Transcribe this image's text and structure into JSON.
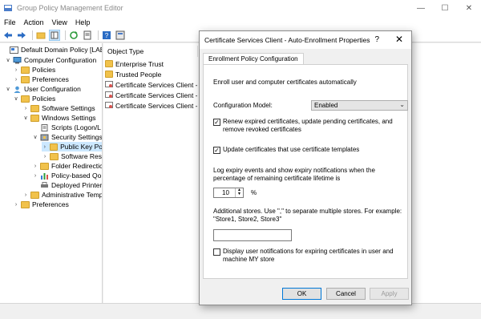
{
  "window": {
    "title": "Group Policy Management Editor"
  },
  "menu": {
    "file": "File",
    "action": "Action",
    "view": "View",
    "help": "Help"
  },
  "tree": [
    {
      "label": "Default Domain Policy [LABDC",
      "indent": 0
    },
    {
      "label": "Computer Configuration",
      "indent": 1
    },
    {
      "label": "Policies",
      "indent": 2
    },
    {
      "label": "Preferences",
      "indent": 2
    },
    {
      "label": "User Configuration",
      "indent": 1
    },
    {
      "label": "Policies",
      "indent": 2
    },
    {
      "label": "Software Settings",
      "indent": 3
    },
    {
      "label": "Windows Settings",
      "indent": 3
    },
    {
      "label": "Scripts (Logon/L",
      "indent": 4
    },
    {
      "label": "Security Settings",
      "indent": 4
    },
    {
      "label": "Public Key Po",
      "indent": 5
    },
    {
      "label": "Software Res",
      "indent": 5
    },
    {
      "label": "Folder Redirectic",
      "indent": 4
    },
    {
      "label": "Policy-based Qo",
      "indent": 4
    },
    {
      "label": "Deployed Printer",
      "indent": 4
    },
    {
      "label": "Administrative Temp",
      "indent": 3
    },
    {
      "label": "Preferences",
      "indent": 2
    }
  ],
  "list": {
    "header": "Object Type",
    "items": [
      "Enterprise Trust",
      "Trusted People",
      "Certificate Services Client - C",
      "Certificate Services Client - C",
      "Certificate Services Client - A"
    ]
  },
  "dialog": {
    "title": "Certificate Services Client - Auto-Enrollment Properties",
    "help": "?",
    "tab": "Enrollment Policy Configuration",
    "intro": "Enroll user and computer certificates automatically",
    "model_label": "Configuration Model:",
    "model_value": "Enabled",
    "renew_label": "Renew expired certificates, update pending certificates, and remove revoked certificates",
    "renew_checked": true,
    "update_label": "Update certificates that use certificate templates",
    "update_checked": true,
    "expiry_text": "Log expiry events and show expiry notifications when the percentage of remaining certificate lifetime is",
    "percent_value": "10",
    "percent_unit": "%",
    "stores_text": "Additional stores. Use \",\" to separate multiple stores. For example: \"Store1, Store2, Store3\"",
    "stores_value": "",
    "display_label": "Display user notifications for expiring certificates in user and machine MY store",
    "display_checked": false,
    "ok": "OK",
    "cancel": "Cancel",
    "apply": "Apply"
  }
}
